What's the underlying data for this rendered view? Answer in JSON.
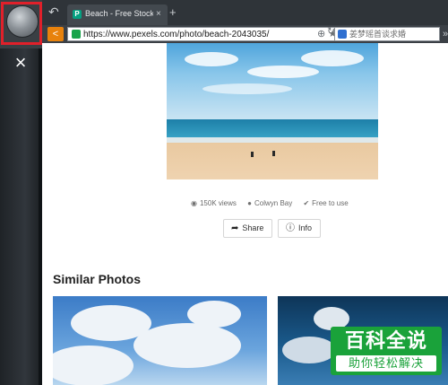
{
  "browser": {
    "tab_title": "Beach - Free Stock P",
    "tab_close": "×",
    "new_tab": "+",
    "url": "https://www.pexels.com/photo/beach-2043035/",
    "search_placeholder": "姜梦瑶首谈求婚",
    "favicon_letter": "P"
  },
  "sidebar": {
    "close_symbol": "×"
  },
  "photo": {
    "views": "150K views",
    "location": "Colwyn Bay",
    "license": "Free to use"
  },
  "actions": {
    "share_label": "Share",
    "info_label": "Info"
  },
  "similar": {
    "title": "Similar Photos"
  },
  "watermark": {
    "line1": "百科全说",
    "line2": "助你轻松解决"
  },
  "colors": {
    "highlight": "#e0202a",
    "accent_orange": "#e8820c",
    "watermark_green": "#1aa23a"
  }
}
